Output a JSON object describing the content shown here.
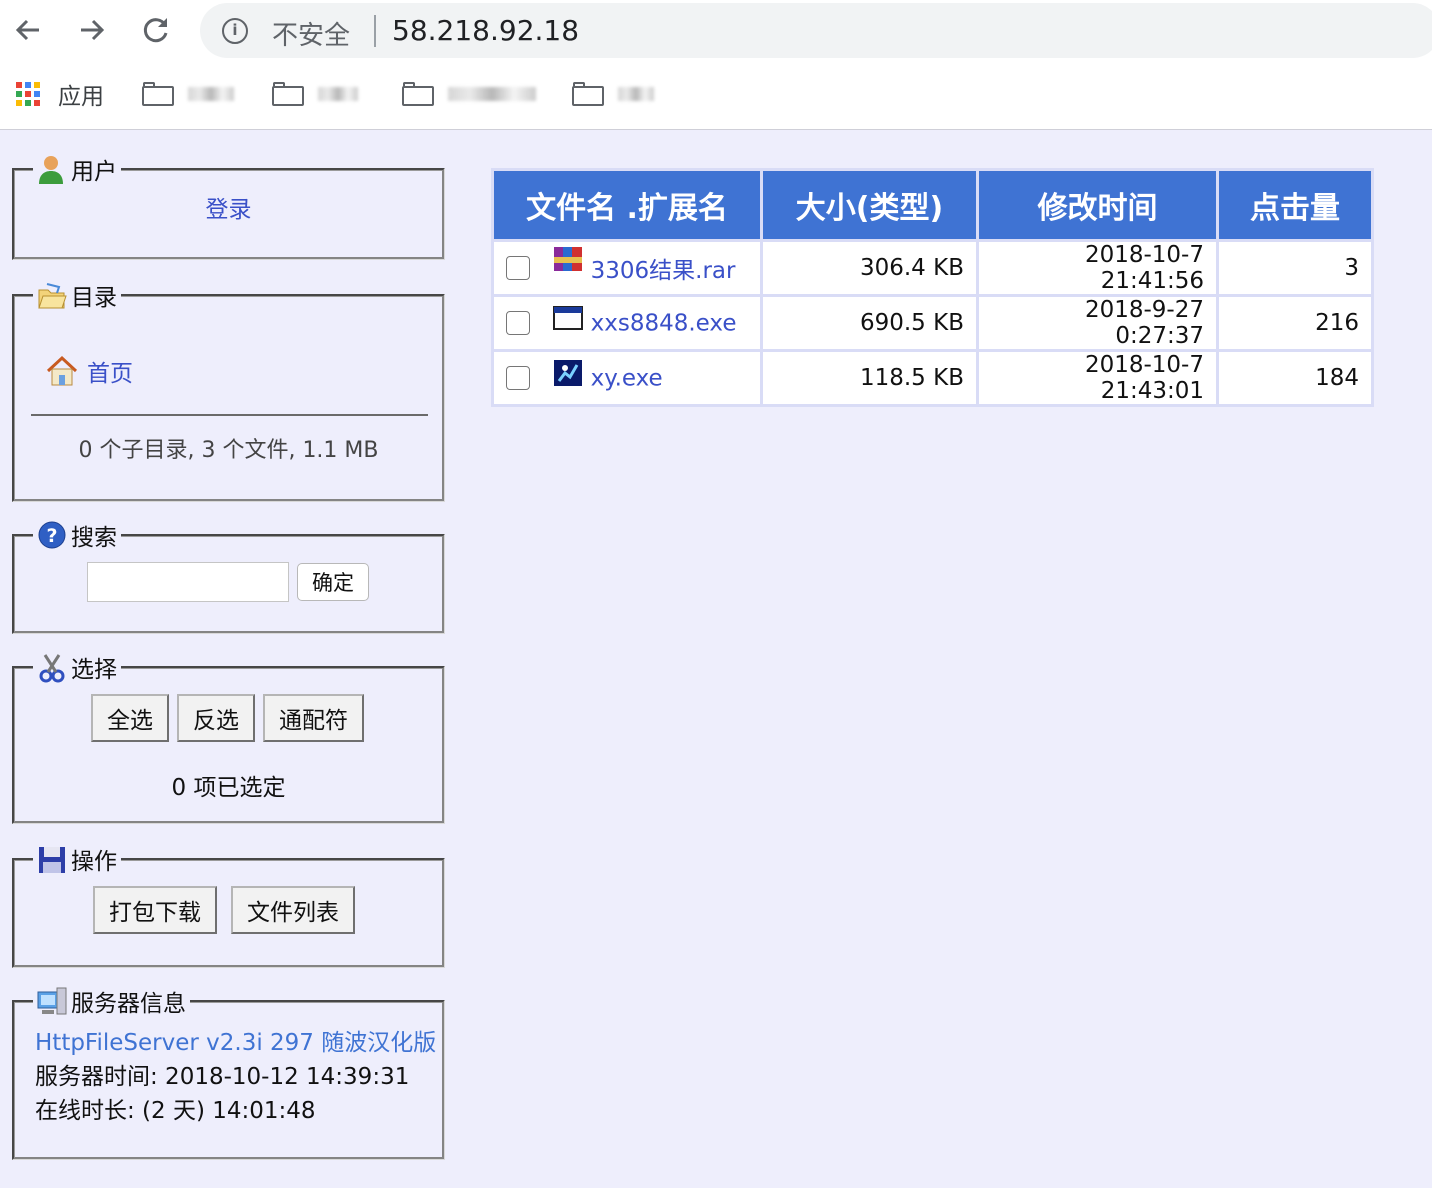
{
  "browser": {
    "security_label": "不安全",
    "url": "58.218.92.18",
    "apps_label": "应用",
    "bookmark_folders": [
      "",
      "",
      "",
      ""
    ]
  },
  "panels": {
    "user": {
      "title": "用户",
      "login_link": "登录"
    },
    "dir": {
      "title": "目录",
      "home_link": "首页",
      "summary": "0 个子目录, 3 个文件, 1.1 MB"
    },
    "search": {
      "title": "搜索",
      "input_value": "",
      "submit_label": "确定"
    },
    "select": {
      "title": "选择",
      "select_all": "全选",
      "invert": "反选",
      "wildcard": "通配符",
      "status": "0 项已选定"
    },
    "actions": {
      "title": "操作",
      "zip_download": "打包下载",
      "file_list": "文件列表"
    },
    "server": {
      "title": "服务器信息",
      "version_link": "HttpFileServer v2.3i 297 随波汉化版",
      "server_time": "服务器时间: 2018-10-12 14:39:31",
      "uptime": "在线时长: (2 天) 14:01:48"
    }
  },
  "table": {
    "headers": [
      "文件名 .扩展名",
      "大小(类型)",
      "修改时间",
      "点击量"
    ],
    "rows": [
      {
        "icon": "rar-archive-icon",
        "name": "3306结果.rar",
        "size": "306.4 KB",
        "modified": "2018-10-7 21:41:56",
        "hits": "3"
      },
      {
        "icon": "exe-window-icon",
        "name": "xxs8848.exe",
        "size": "690.5 KB",
        "modified": "2018-9-27 0:27:37",
        "hits": "216"
      },
      {
        "icon": "exe-app-icon",
        "name": "xy.exe",
        "size": "118.5 KB",
        "modified": "2018-10-7 21:43:01",
        "hits": "184"
      }
    ]
  },
  "colors": {
    "page_bg": "#eeeefc",
    "header_bg": "#3f73d3",
    "link": "#3a50c8"
  }
}
